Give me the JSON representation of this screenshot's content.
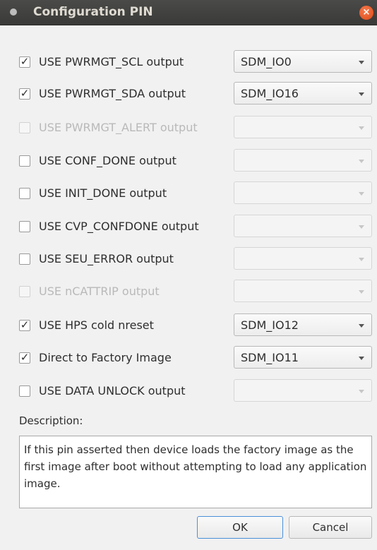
{
  "window": {
    "title": "Configuration PIN",
    "close_glyph": "×"
  },
  "rows": [
    {
      "label": "USE PWRMGT_SCL output",
      "checked": "✓",
      "value": "SDM_IO0"
    },
    {
      "label": "USE PWRMGT_SDA output",
      "checked": "✓",
      "value": "SDM_IO16"
    },
    {
      "label": "USE PWRMGT_ALERT output",
      "checked": "",
      "value": ""
    },
    {
      "label": "USE CONF_DONE output",
      "checked": "",
      "value": ""
    },
    {
      "label": "USE INIT_DONE output",
      "checked": "",
      "value": ""
    },
    {
      "label": "USE CVP_CONFDONE output",
      "checked": "",
      "value": ""
    },
    {
      "label": "USE SEU_ERROR output",
      "checked": "",
      "value": ""
    },
    {
      "label": "USE nCATTRIP output",
      "checked": "",
      "value": ""
    },
    {
      "label": "USE HPS cold nreset",
      "checked": "✓",
      "value": "SDM_IO12"
    },
    {
      "label": "Direct to Factory Image",
      "checked": "✓",
      "value": "SDM_IO11"
    },
    {
      "label": "USE DATA UNLOCK output",
      "checked": "",
      "value": ""
    }
  ],
  "description": {
    "label": "Description:",
    "text": "If this pin asserted then device loads the factory image as the first image after boot without attempting to load any application image."
  },
  "buttons": {
    "ok": "OK",
    "cancel": "Cancel"
  }
}
